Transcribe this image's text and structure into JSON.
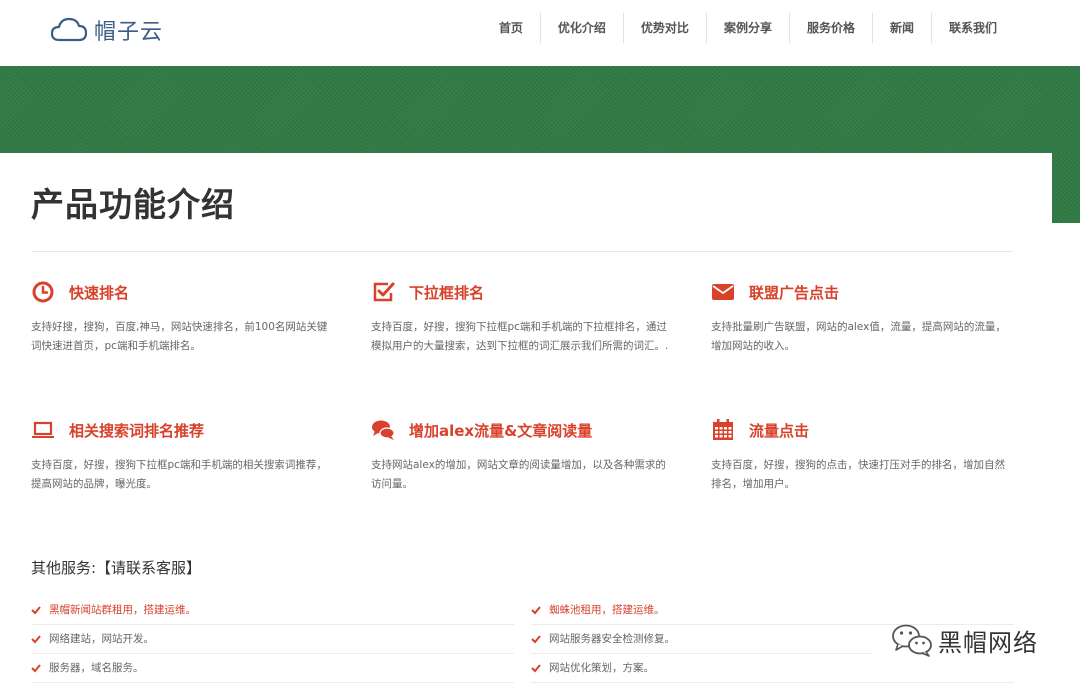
{
  "brand": {
    "name": "帽子云"
  },
  "nav": [
    {
      "label": "首页"
    },
    {
      "label": "优化介绍"
    },
    {
      "label": "优势对比"
    },
    {
      "label": "案例分享"
    },
    {
      "label": "服务价格"
    },
    {
      "label": "新闻"
    },
    {
      "label": "联系我们"
    }
  ],
  "page": {
    "title": "产品功能介绍"
  },
  "features": [
    {
      "icon": "clock-icon",
      "title": "快速排名",
      "desc": "支持好搜，搜狗，百度,神马，网站快速排名，前100名网站关键词快速进首页，pc端和手机端排名。"
    },
    {
      "icon": "checkbox-icon",
      "title": "下拉框排名",
      "desc": "支持百度，好搜，搜狗下拉框pc端和手机端的下拉框排名，通过模拟用户的大量搜索，达到下拉框的词汇展示我们所需的词汇。."
    },
    {
      "icon": "envelope-icon",
      "title": "联盟广告点击",
      "desc": "支持批量刷广告联盟，网站的alex值，流量，提高网站的流量，增加网站的收入。"
    },
    {
      "icon": "laptop-icon",
      "title": "相关搜索词排名推荐",
      "desc": "支持百度，好搜，搜狗下拉框pc端和手机端的相关搜索词推荐，提高网站的品牌，曝光度。"
    },
    {
      "icon": "chat-bubbles-icon",
      "title": "增加alex流量&文章阅读量",
      "desc": "支持网站alex的增加，网站文章的阅读量增加，以及各种需求的访问量。"
    },
    {
      "icon": "calendar-icon",
      "title": "流量点击",
      "desc": "支持百度，好搜，搜狗的点击，快速打压对手的排名，增加自然排名，增加用户。"
    }
  ],
  "services": {
    "title": "其他服务:【请联系客服】",
    "items": [
      {
        "text": "黑帽新闻站群租用，搭建运维。",
        "highlight": true
      },
      {
        "text": "蜘蛛池租用，搭建运维。",
        "highlight": true
      },
      {
        "text": "网络建站，网站开发。",
        "highlight": false
      },
      {
        "text": "网站服务器安全检测修复。",
        "highlight": false
      },
      {
        "text": "服务器，域名服务。",
        "highlight": false
      },
      {
        "text": "网站优化策划，方案。",
        "highlight": false
      }
    ]
  },
  "watermark": {
    "text": "黑帽网络"
  },
  "colors": {
    "accent": "#d9412b",
    "band": "#2f7a44",
    "logo": "#3b5d86"
  }
}
